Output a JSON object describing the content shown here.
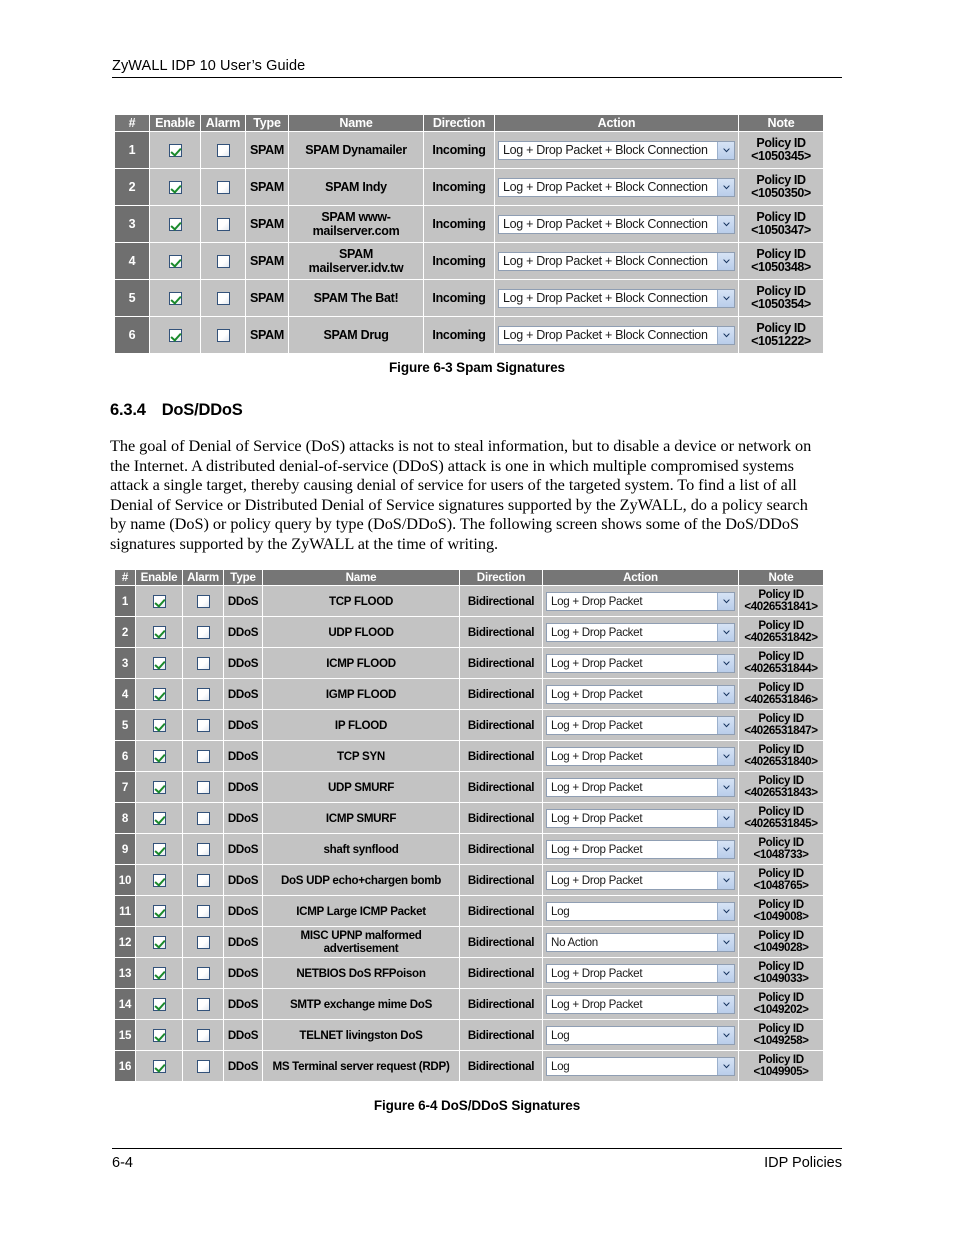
{
  "header": {
    "title": "ZyWALL IDP 10 User’s Guide"
  },
  "footer": {
    "page_number": "6-4",
    "section_name": "IDP Policies"
  },
  "section": {
    "number": "6.3.4",
    "title": "DoS/DDoS",
    "body": "The goal of Denial of Service (DoS) attacks is not to steal information, but to disable a device or network on the Internet. A distributed denial-of-service (DDoS) attack is one in which multiple compromised systems attack a single target, thereby causing denial of service for users of the targeted system. To find a list of all Denial of Service or Distributed Denial of Service signatures supported by the ZyWALL, do a policy search by name (DoS) or policy query by type (DoS/DDoS). The following screen shows some of the DoS/DDoS signatures supported by the ZyWALL at the time of writing."
  },
  "figure_spam": {
    "caption": "Figure 6-3 Spam Signatures",
    "columns": [
      "#",
      "Enable",
      "Alarm",
      "Type",
      "Name",
      "Direction",
      "Action",
      "Note"
    ],
    "note_label": "Policy ID",
    "dropdown_icon": "chevron-down-icon",
    "rows": [
      {
        "num": "1",
        "enable": true,
        "alarm": false,
        "type": "SPAM",
        "name": "SPAM Dynamailer",
        "direction": "Incoming",
        "action": "Log + Drop Packet + Block Connection",
        "policy_id": "<1050345>"
      },
      {
        "num": "2",
        "enable": true,
        "alarm": false,
        "type": "SPAM",
        "name": "SPAM Indy",
        "direction": "Incoming",
        "action": "Log + Drop Packet + Block Connection",
        "policy_id": "<1050350>"
      },
      {
        "num": "3",
        "enable": true,
        "alarm": false,
        "type": "SPAM",
        "name": "SPAM www-mailserver.com",
        "direction": "Incoming",
        "action": "Log + Drop Packet + Block Connection",
        "policy_id": "<1050347>"
      },
      {
        "num": "4",
        "enable": true,
        "alarm": false,
        "type": "SPAM",
        "name": "SPAM mailserver.idv.tw",
        "direction": "Incoming",
        "action": "Log + Drop Packet + Block Connection",
        "policy_id": "<1050348>"
      },
      {
        "num": "5",
        "enable": true,
        "alarm": false,
        "type": "SPAM",
        "name": "SPAM The Bat!",
        "direction": "Incoming",
        "action": "Log + Drop Packet + Block Connection",
        "policy_id": "<1050354>"
      },
      {
        "num": "6",
        "enable": true,
        "alarm": false,
        "type": "SPAM",
        "name": "SPAM Drug",
        "direction": "Incoming",
        "action": "Log + Drop Packet + Block Connection",
        "policy_id": "<1051222>"
      }
    ]
  },
  "figure_dos": {
    "caption": "Figure 6-4 DoS/DDoS Signatures",
    "columns": [
      "#",
      "Enable",
      "Alarm",
      "Type",
      "Name",
      "Direction",
      "Action",
      "Note"
    ],
    "note_label": "Policy ID",
    "dropdown_icon": "chevron-down-icon",
    "rows": [
      {
        "num": "1",
        "enable": true,
        "alarm": false,
        "type": "DDoS",
        "name": "TCP FLOOD",
        "direction": "Bidirectional",
        "action": "Log + Drop Packet",
        "policy_id": "<4026531841>"
      },
      {
        "num": "2",
        "enable": true,
        "alarm": false,
        "type": "DDoS",
        "name": "UDP FLOOD",
        "direction": "Bidirectional",
        "action": "Log + Drop Packet",
        "policy_id": "<4026531842>"
      },
      {
        "num": "3",
        "enable": true,
        "alarm": false,
        "type": "DDoS",
        "name": "ICMP FLOOD",
        "direction": "Bidirectional",
        "action": "Log + Drop Packet",
        "policy_id": "<4026531844>"
      },
      {
        "num": "4",
        "enable": true,
        "alarm": false,
        "type": "DDoS",
        "name": "IGMP FLOOD",
        "direction": "Bidirectional",
        "action": "Log + Drop Packet",
        "policy_id": "<4026531846>"
      },
      {
        "num": "5",
        "enable": true,
        "alarm": false,
        "type": "DDoS",
        "name": "IP FLOOD",
        "direction": "Bidirectional",
        "action": "Log + Drop Packet",
        "policy_id": "<4026531847>"
      },
      {
        "num": "6",
        "enable": true,
        "alarm": false,
        "type": "DDoS",
        "name": "TCP SYN",
        "direction": "Bidirectional",
        "action": "Log + Drop Packet",
        "policy_id": "<4026531840>"
      },
      {
        "num": "7",
        "enable": true,
        "alarm": false,
        "type": "DDoS",
        "name": "UDP SMURF",
        "direction": "Bidirectional",
        "action": "Log + Drop Packet",
        "policy_id": "<4026531843>"
      },
      {
        "num": "8",
        "enable": true,
        "alarm": false,
        "type": "DDoS",
        "name": "ICMP SMURF",
        "direction": "Bidirectional",
        "action": "Log + Drop Packet",
        "policy_id": "<4026531845>"
      },
      {
        "num": "9",
        "enable": true,
        "alarm": false,
        "type": "DDoS",
        "name": "shaft synflood",
        "direction": "Bidirectional",
        "action": "Log + Drop Packet",
        "policy_id": "<1048733>"
      },
      {
        "num": "10",
        "enable": true,
        "alarm": false,
        "type": "DDoS",
        "name": "DoS UDP echo+chargen bomb",
        "direction": "Bidirectional",
        "action": "Log + Drop Packet",
        "policy_id": "<1048765>"
      },
      {
        "num": "11",
        "enable": true,
        "alarm": false,
        "type": "DDoS",
        "name": "ICMP Large ICMP Packet",
        "direction": "Bidirectional",
        "action": "Log",
        "policy_id": "<1049008>"
      },
      {
        "num": "12",
        "enable": true,
        "alarm": false,
        "type": "DDoS",
        "name": "MISC UPNP malformed advertisement",
        "direction": "Bidirectional",
        "action": "No Action",
        "policy_id": "<1049028>"
      },
      {
        "num": "13",
        "enable": true,
        "alarm": false,
        "type": "DDoS",
        "name": "NETBIOS DoS RFPoison",
        "direction": "Bidirectional",
        "action": "Log + Drop Packet",
        "policy_id": "<1049033>"
      },
      {
        "num": "14",
        "enable": true,
        "alarm": false,
        "type": "DDoS",
        "name": "SMTP exchange mime DoS",
        "direction": "Bidirectional",
        "action": "Log + Drop Packet",
        "policy_id": "<1049202>"
      },
      {
        "num": "15",
        "enable": true,
        "alarm": false,
        "type": "DDoS",
        "name": "TELNET livingston DoS",
        "direction": "Bidirectional",
        "action": "Log",
        "policy_id": "<1049258>"
      },
      {
        "num": "16",
        "enable": true,
        "alarm": false,
        "type": "DDoS",
        "name": "MS Terminal server request (RDP)",
        "direction": "Bidirectional",
        "action": "Log",
        "policy_id": "<1049905>"
      }
    ]
  },
  "colors": {
    "header_bg": "#767676",
    "row_bg": "#c3c3c3",
    "num_bg": "#6f6f6f",
    "check_green": "#1a8a2b",
    "select_btn": "#b9cdea"
  }
}
